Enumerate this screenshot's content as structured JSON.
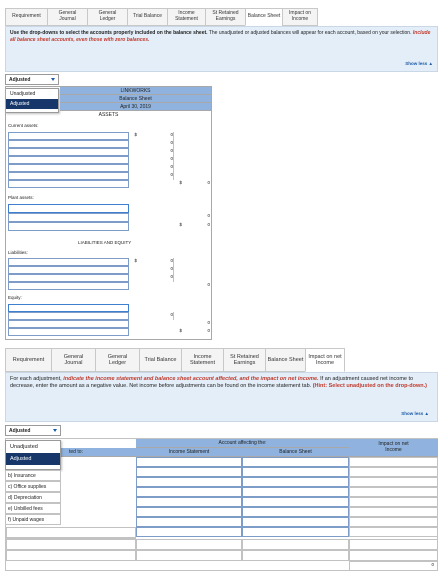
{
  "tabs_top": [
    "General\nJournal",
    "General\nLedger",
    "Trial Balance",
    "Income\nStatement",
    "St Retained\nEarnings",
    "Balance Sheet",
    "Impact on\nIncome"
  ],
  "tabs_top_first": "Requirement",
  "instr_top": {
    "text1": "Use the drop-downs to select the accounts properly included on the balance sheet.",
    "text2": " The unadjusted or adjusted balances will appear for each account, based on your selection. ",
    "text3": "Include all balance sheet accounts, even those with zero balances."
  },
  "show_less": "Show less ▲",
  "dropdown_top": {
    "value": "Adjusted",
    "options": [
      "Unadjusted",
      "Adjusted"
    ]
  },
  "balance_sheet": {
    "company": "LINKWORKS",
    "title": "Balance Sheet",
    "date": "April 30, 2019",
    "assets": "ASSETS",
    "current_assets": "Current assets:",
    "plant_assets": "Plant assets:",
    "liab_equity": "LIABILITIES AND EQUITY",
    "liabilities": "Liabilities:",
    "equity": "Equity:",
    "dollar": "$",
    "zero": "0"
  },
  "tabs_bottom": [
    "General\nJournal",
    "General\nLedger",
    "Trial Balance",
    "Income\nStatement",
    "St Retained\nEarnings",
    "Balance Sheet",
    "Impact on net\nIncome"
  ],
  "tabs_bottom_first": "Requirement",
  "instr_bottom": {
    "text1": "For each adjustment, ",
    "text2": "indicate the income statement and balance sheet account affected, and the impact on net income.",
    "text3": " If an adjustment caused net income to decrease, enter the amount as a negative value. Net income before adjustments can be found on the income statement tab.",
    "hint": "(Hint: Select unadjusted on the drop-down.)"
  },
  "dropdown_bottom": {
    "value": "Adjusted",
    "options": [
      "Unadjusted",
      "Adjusted"
    ]
  },
  "adjust_table": {
    "header_group": "Account affecting the:",
    "col_related": "ted to:",
    "col_income": "Income Statement",
    "col_balance": "Balance Sheet",
    "col_impact": "Impact on net\nIncome",
    "rows": [
      "b) Insurance",
      "c) Office supplies",
      "d) Depreciation",
      "e) Unbilled fees",
      "f) Unpaid wages"
    ],
    "total_zero": "0"
  }
}
